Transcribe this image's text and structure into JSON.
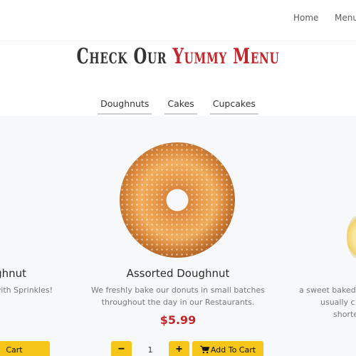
{
  "nav": {
    "home": "Home",
    "menu": "Menu"
  },
  "section": {
    "title_dark": "Check Our",
    "title_accent": "Yummy Menu"
  },
  "tabs": [
    {
      "label": "Doughnuts"
    },
    {
      "label": "Cakes"
    },
    {
      "label": "Cupcakes"
    }
  ],
  "items": {
    "left": {
      "name": "ghnut",
      "desc": "with Sprinkles!",
      "add_label": "Cart"
    },
    "center": {
      "name": "Assorted Doughnut",
      "desc": "We freshly bake our donuts in small batches throughout the day in our Restaurants.",
      "price": "$5.99",
      "qty": "1",
      "minus": "−",
      "plus": "+",
      "add_label": "Add To Cart"
    },
    "right": {
      "desc_line1": "a sweet baked",
      "desc_line2": "usually c",
      "desc_line3": "shorte"
    }
  },
  "colors": {
    "accent_red": "#c0272d",
    "button_yellow": "#f5c518"
  }
}
